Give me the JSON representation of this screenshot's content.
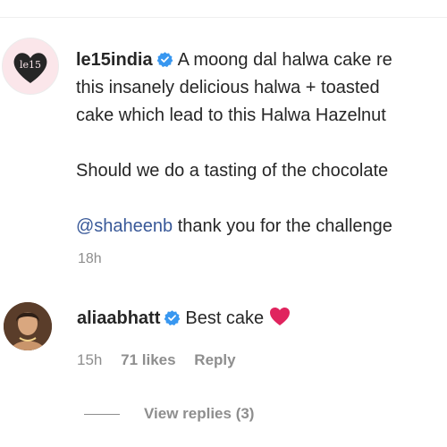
{
  "post": {
    "username": "le15india",
    "verified_icon": "verified-badge-icon",
    "caption_line1": "A moong dal halwa cake re",
    "caption_line2": "this insanely delicious halwa + toasted",
    "caption_line3": "cake which lead to this Halwa Hazelnut",
    "caption_line4": "Should we do a tasting of the chocolate",
    "mention": "@shaheenb",
    "mention_text": " thank you for the challenge",
    "timestamp": "18h",
    "avatar_label": "le15"
  },
  "comment": {
    "username": "aliaabhatt",
    "text": "Best cake",
    "emoji_icon": "red-heart-icon",
    "timestamp": "15h",
    "likes": "71 likes",
    "reply_label": "Reply"
  },
  "view_replies": "View replies (3)",
  "colors": {
    "verified": "#3897f0",
    "mention": "#385898",
    "heart": "#e0245e",
    "meta": "#8e8e8e"
  }
}
